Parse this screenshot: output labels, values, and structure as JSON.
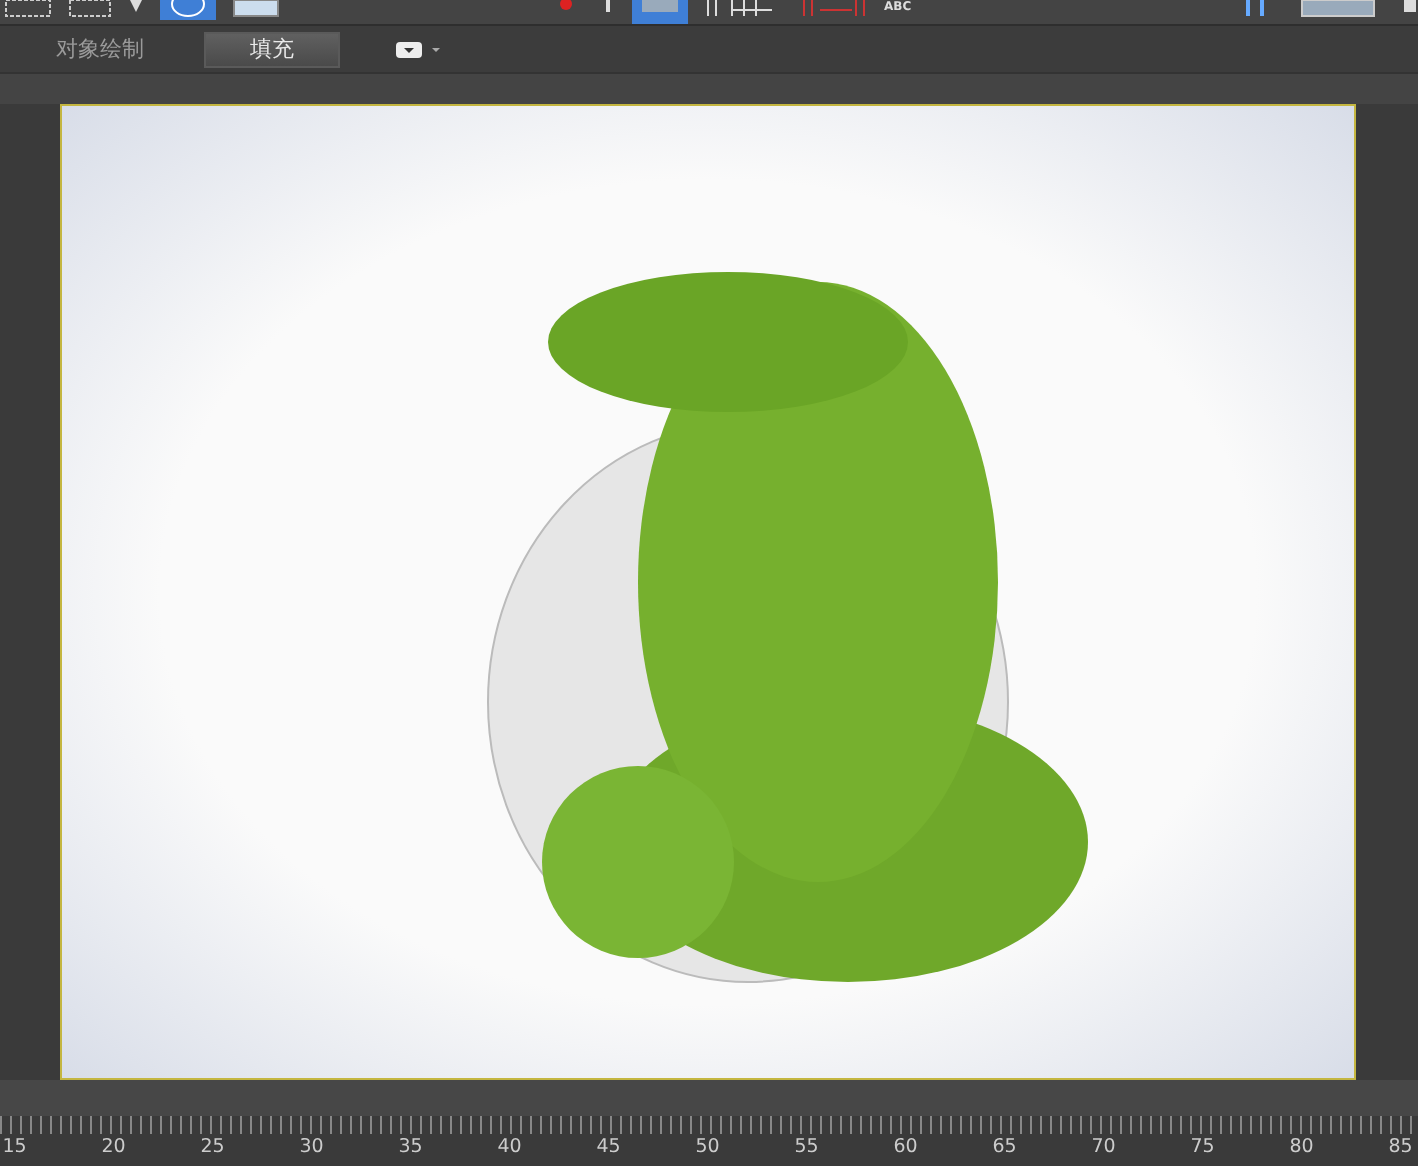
{
  "toolbar": {
    "text_label": "ABC"
  },
  "tabs": [
    {
      "label": "对象绘制",
      "selected": false
    },
    {
      "label": "填充",
      "selected": true
    }
  ],
  "ruler": {
    "labels": [
      "15",
      "20",
      "25",
      "30",
      "35",
      "40",
      "45",
      "50",
      "55",
      "60",
      "65",
      "70",
      "75",
      "80",
      "85"
    ]
  }
}
